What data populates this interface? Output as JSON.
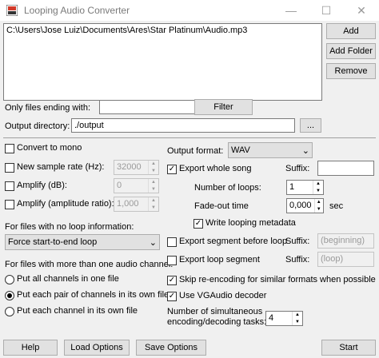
{
  "window": {
    "title": "Looping Audio Converter",
    "minimize_glyph": "—",
    "maximize_glyph": "☐",
    "close_glyph": "✕"
  },
  "file_list": {
    "items": [
      "C:\\Users\\Jose Luiz\\Documents\\Ares\\Star Platinum\\Audio.mp3"
    ]
  },
  "buttons": {
    "add": "Add",
    "add_folder": "Add Folder",
    "remove": "Remove",
    "filter": "Filter",
    "browse": "...",
    "help": "Help",
    "load_options": "Load Options",
    "save_options": "Save Options",
    "start": "Start"
  },
  "filter": {
    "label": "Only files ending with:",
    "value": ""
  },
  "output_dir": {
    "label": "Output directory:",
    "value": "./output"
  },
  "left": {
    "convert_mono": {
      "label": "Convert to mono",
      "checked": false
    },
    "sample_rate": {
      "label": "New sample rate (Hz):",
      "checked": false,
      "value": "32000"
    },
    "amplify_db": {
      "label": "Amplify (dB):",
      "checked": false,
      "value": "0"
    },
    "amplify_ratio": {
      "label": "Amplify (amplitude ratio):",
      "checked": false,
      "value": "1,000"
    },
    "no_loop_label": "For files with no loop information:",
    "no_loop_selected": "Force start-to-end loop",
    "channels_label": "For files with more than one audio channel:",
    "channel_options": [
      {
        "label": "Put all channels in one file",
        "selected": false
      },
      {
        "label": "Put each pair of channels in its own file",
        "selected": true
      },
      {
        "label": "Put each channel in its own file",
        "selected": false
      }
    ]
  },
  "right": {
    "output_format_label": "Output format:",
    "output_format_value": "WAV",
    "export_whole": {
      "label": "Export whole song",
      "checked": true
    },
    "suffix_label": "Suffix:",
    "suffix_whole": "",
    "loops_label": "Number of loops:",
    "loops_value": "1",
    "fade_label": "Fade-out time",
    "fade_value": "0,000",
    "fade_unit": "sec",
    "write_meta": {
      "label": "Write looping metadata",
      "checked": true
    },
    "export_before": {
      "label": "Export segment before loop",
      "checked": false,
      "suffix": "(beginning)"
    },
    "export_loop": {
      "label": "Export loop segment",
      "checked": false,
      "suffix": "(loop)"
    },
    "skip_reencode": {
      "label": "Skip re-encoding for similar formats when possible",
      "checked": true
    },
    "vgaudio": {
      "label": "Use VGAudio decoder",
      "checked": true
    },
    "tasks_label_1": "Number of simultaneous",
    "tasks_label_2": "encoding/decoding tasks:",
    "tasks_value": "4"
  },
  "glyphs": {
    "check": "✓",
    "dropdown": "⌄",
    "spin_up": "▲",
    "spin_down": "▼"
  },
  "colors": {
    "icon_red": "#d23a2a",
    "icon_dark": "#333333"
  }
}
